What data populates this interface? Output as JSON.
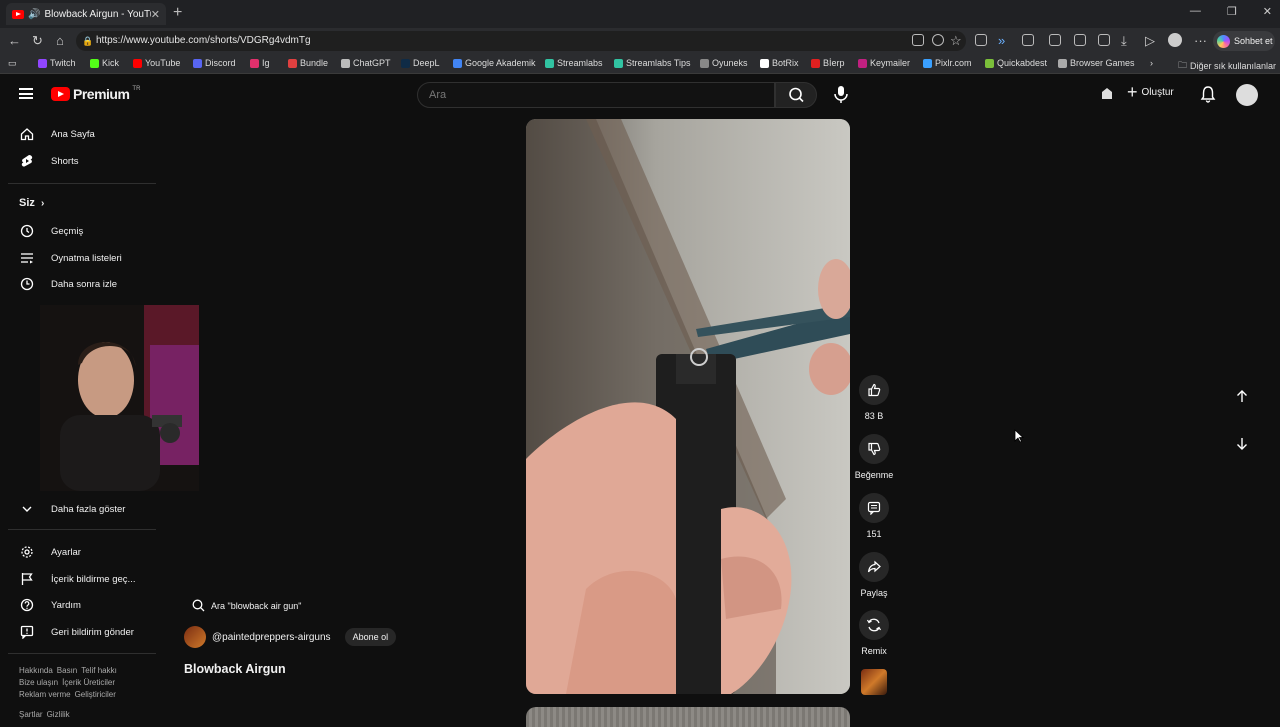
{
  "browser": {
    "tab_title": "Blowback Airgun - YouTube",
    "url": "https://www.youtube.com/shorts/VDGRg4vdmTg",
    "copilot_label": "Sohbet et",
    "bookmarks": [
      {
        "label": "Twitch",
        "color": "#9146ff"
      },
      {
        "label": "Kick",
        "color": "#53fc18"
      },
      {
        "label": "YouTube",
        "color": "#ff0000"
      },
      {
        "label": "Discord",
        "color": "#5865f2"
      },
      {
        "label": "Ig",
        "color": "#e1306c"
      },
      {
        "label": "Bundle",
        "color": "#e04040"
      },
      {
        "label": "ChatGPT",
        "color": "#bbbbbb"
      },
      {
        "label": "DeepL",
        "color": "#0f2b46"
      },
      {
        "label": "Google Akademik",
        "color": "#4285f4"
      },
      {
        "label": "Streamlabs",
        "color": "#31c3a2"
      },
      {
        "label": "Streamlabs Tips",
        "color": "#31c3a2"
      },
      {
        "label": "Oyuneks",
        "color": "#888888"
      },
      {
        "label": "BotRix",
        "color": "#ffffff"
      },
      {
        "label": "Bİerp",
        "color": "#e02020"
      },
      {
        "label": "Keymailer",
        "color": "#c02080"
      },
      {
        "label": "Pixlr.com",
        "color": "#3aa0ff"
      },
      {
        "label": "Quickabdest",
        "color": "#7bbf3a"
      },
      {
        "label": "Browser Games",
        "color": "#aaaaaa"
      }
    ],
    "other_bookmarks": "Diğer sık kullanılanlar"
  },
  "youtube": {
    "logo_text": "Premium",
    "logo_region": "TR",
    "search_placeholder": "Ara",
    "create_label": "Oluştur",
    "sidebar": {
      "main": [
        {
          "label": "Ana Sayfa",
          "icon": "home-icon"
        },
        {
          "label": "Shorts",
          "icon": "shorts-icon"
        }
      ],
      "you_header": "Siz",
      "you_items": [
        {
          "label": "Geçmiş",
          "icon": "history-icon"
        },
        {
          "label": "Oynatma listeleri",
          "icon": "playlist-icon"
        },
        {
          "label": "Daha sonra izle",
          "icon": "watch-later-icon"
        }
      ],
      "show_more": "Daha fazla göster",
      "settings_items": [
        {
          "label": "Ayarlar",
          "icon": "gear-icon"
        },
        {
          "label": "İçerik bildirme geç...",
          "icon": "flag-icon"
        },
        {
          "label": "Yardım",
          "icon": "help-icon"
        },
        {
          "label": "Geri bildirim gönder",
          "icon": "feedback-icon"
        }
      ],
      "footer_lines": [
        [
          "Hakkında",
          "Basın",
          "Telif hakkı"
        ],
        [
          "Bize ulaşın",
          "İçerik Üreticiler"
        ],
        [
          "Reklam verme",
          "Geliştiriciler"
        ],
        [
          "Şartlar",
          "Gizlilik"
        ]
      ]
    },
    "short": {
      "search_suggestion": "Ara \"blowback air gun\"",
      "channel": "@paintedpreppers-airguns",
      "subscribe": "Abone ol",
      "title": "Blowback Airgun",
      "actions": {
        "likes": "83 B",
        "dislike": "Beğenme",
        "comments": "151",
        "share": "Paylaş",
        "remix": "Remix"
      }
    }
  }
}
